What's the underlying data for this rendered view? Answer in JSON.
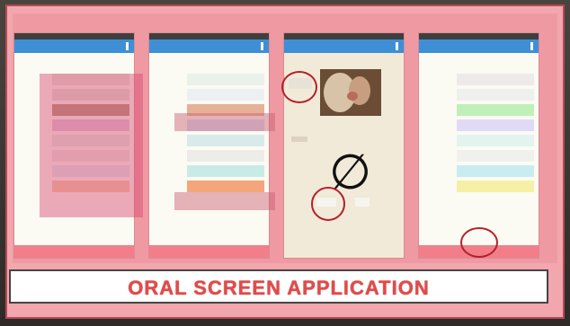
{
  "poster_title": "ORAL SCREEN APPLICATION",
  "colors": {
    "poster": "#f2a6ad",
    "appbar": "#3e8fd6",
    "accent": "#e24a4a"
  },
  "phones": [
    {
      "items": [
        "",
        "",
        "",
        "",
        "",
        "",
        "",
        ""
      ],
      "row_colors": [
        "#e7e2d8",
        "#e2e0d6",
        "#b49a7e",
        "#e1c6dc",
        "#e4e8e4",
        "#ece6df",
        "#e0e8ee",
        "#f6cbb0"
      ]
    },
    {
      "items": [
        "",
        "",
        "",
        "",
        "",
        "",
        "",
        ""
      ],
      "row_colors": [
        "#e9f1ea",
        "#edf0f2",
        "#e5b197",
        "#d8ddf4",
        "#d9eaeb",
        "#ecece9",
        "#c9ebe6",
        "#f4a67a"
      ]
    },
    {
      "image": "face-photo-icon",
      "symbol": "∅"
    },
    {
      "items": [
        "",
        "",
        "",
        "",
        "",
        "",
        "",
        ""
      ],
      "row_colors": [
        "#eeeaea",
        "#eef0ee",
        "#bff0b8",
        "#e1daf6",
        "#e3f4ef",
        "#eff2ec",
        "#c9ecf0",
        "#f6f0a6"
      ]
    }
  ]
}
